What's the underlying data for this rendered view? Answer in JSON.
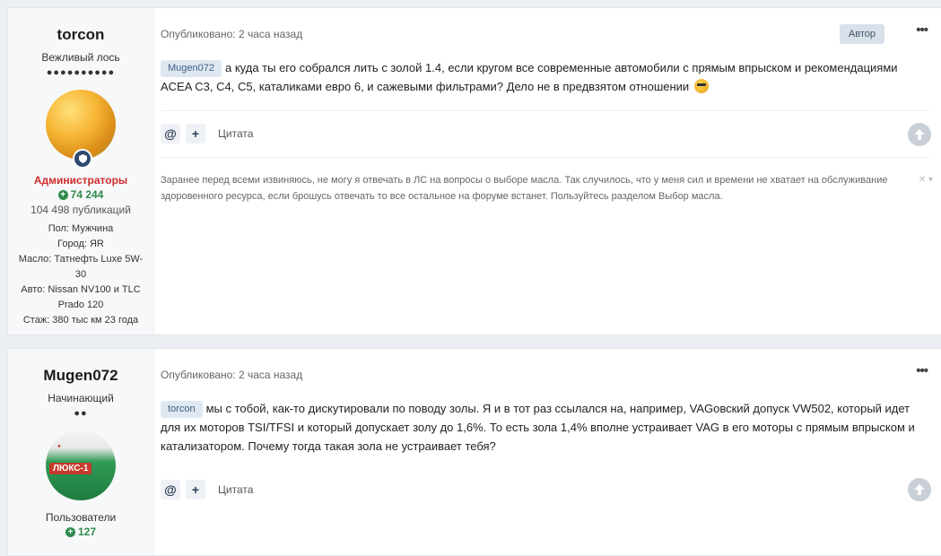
{
  "posts": [
    {
      "author": {
        "name": "torcon",
        "rank": "Вежливый лось",
        "rank_dots": "●●●●●●●●●●",
        "group": "Администраторы",
        "reputation": "74 244",
        "posts_count": "104 498 публикаций",
        "info_lines": [
          "Пол: Мужчина",
          "Город: ЯR",
          "Масло: Татнефть Luxe 5W-30",
          "Авто: Nissan NV100 и TLC Prado 120",
          "Стаж: 380 тыс км 23 года"
        ]
      },
      "published": "Опубликовано: 2 часа назад",
      "author_badge": "Автор",
      "mention": "Mugen072",
      "text": "а куда ты его собрался лить с золой 1.4, если кругом все современные автомобили с прямым впрыском и рекомендациями ACEA C3, C4, C5, каталиками евро 6, и сажевыми фильтрами? Дело не в предвзятом отношении",
      "quote_label": "Цитата",
      "signature": "Заранее перед всеми извиняюсь, не могу я отвечать в ЛС на вопросы о выборе масла. Так случилось, что у меня сил и времени не хватает на обслуживание здоровенного ресурса, если брошусь отвечать то все остальное на форуме встанет. Пользуйтесь разделом Выбор масла."
    },
    {
      "author": {
        "name": "Mugen072",
        "rank": "Начинающий",
        "rank_dots": "●●",
        "group": "Пользователи",
        "reputation": "127",
        "avatar_text": "ЛЮКС-1"
      },
      "published": "Опубликовано: 2 часа назад",
      "mention": "torcon",
      "text": "мы с тобой, как-то дискутировали по поводу золы. Я и в тот раз ссылался на, например, VAGовский допуск VW502, который идет для их моторов TSI/TFSI и который допускает золу до 1,6%. То есть зола 1,4% вполне устраивает VAG в его моторы с прямым впрыском и катализатором. Почему тогда такая зола не устраивает тебя?",
      "quote_label": "Цитата"
    }
  ],
  "icons": {
    "mention": "@",
    "add": "+",
    "more": "•••"
  },
  "colors": {
    "admin_group": "#d02b2b",
    "reputation": "#2f8a4b",
    "mention_bg": "#dfe8f1"
  }
}
